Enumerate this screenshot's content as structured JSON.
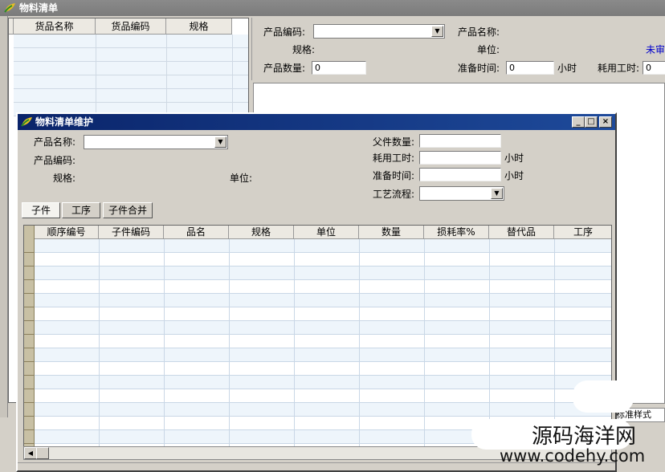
{
  "background_window": {
    "title": "物料清单",
    "list_columns": [
      "货品名称",
      "货品编码",
      "规格"
    ],
    "labels": {
      "product_code": "产品编码:",
      "product_name": "产品名称:",
      "spec": "规格:",
      "unit": "单位:",
      "status": "未审",
      "product_qty": "产品数量:",
      "prep_time": "准备时间:",
      "hours_unit": "小时",
      "labor_time": "耗用工时:"
    },
    "values": {
      "product_qty": "0",
      "prep_time": "0",
      "labor_time": "0"
    },
    "style_field": "标准样式"
  },
  "dialog": {
    "title": "物料清单维护",
    "title_buttons": {
      "minimize": "_",
      "maximize": "□",
      "close": "×"
    },
    "labels": {
      "product_name": "产品名称:",
      "product_code": "产品编码:",
      "spec": "规格:",
      "unit": "单位:",
      "parent_qty": "父件数量:",
      "labor_time": "耗用工时:",
      "hours_unit_1": "小时",
      "prep_time": "准备时间:",
      "hours_unit_2": "小时",
      "process_flow": "工艺流程:"
    },
    "tabs": [
      "子件",
      "工序",
      "子件合并"
    ],
    "grid_columns": [
      "顺序编号",
      "子件编码",
      "品名",
      "规格",
      "单位",
      "数量",
      "损耗率%",
      "替代品",
      "工序"
    ]
  },
  "watermark": {
    "text": "源码海洋网",
    "url": "www.codehy.com"
  },
  "colors": {
    "title_active": "#0a246a",
    "title_inactive": "#808080",
    "window_face": "#d4d0c8",
    "status_text": "#0000cc"
  }
}
